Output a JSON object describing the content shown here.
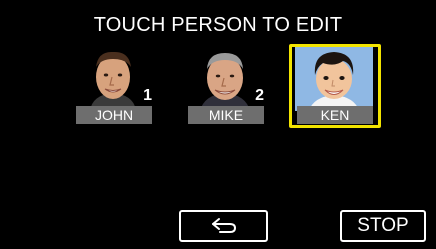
{
  "header": {
    "title": "TOUCH PERSON TO EDIT"
  },
  "people": [
    {
      "name": "JOHN",
      "number": "1",
      "selected": false,
      "face_icon": "adult-man-photo"
    },
    {
      "name": "MIKE",
      "number": "2",
      "selected": false,
      "face_icon": "older-man-photo"
    },
    {
      "name": "KEN",
      "number": "",
      "selected": true,
      "face_icon": "child-photo"
    }
  ],
  "footer": {
    "back_icon": "return-arrow-icon",
    "stop_label": "STOP"
  },
  "colors": {
    "background": "#000000",
    "selection_frame": "#f2e400",
    "name_bar": "#6e6e6e"
  }
}
